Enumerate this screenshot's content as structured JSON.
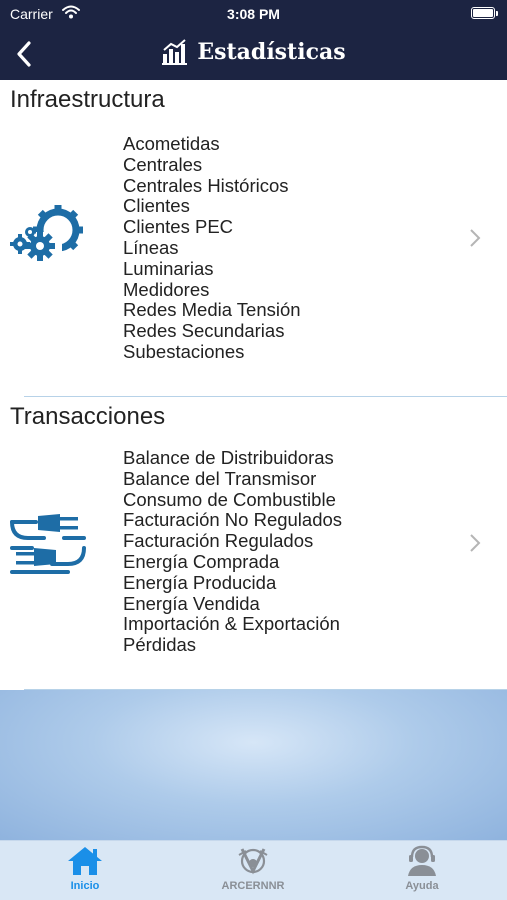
{
  "status_bar": {
    "carrier": "Carrier",
    "time": "3:08 PM"
  },
  "nav": {
    "title": "Estadísticas",
    "back_icon": "chevron-left-icon",
    "title_icon": "bar-chart-icon"
  },
  "sections": [
    {
      "title": "Infraestructura",
      "icon": "gears-icon",
      "items": [
        "Acometidas",
        "Centrales",
        "Centrales Históricos",
        "Clientes",
        "Clientes PEC",
        "Líneas",
        "Luminarias",
        "Medidores",
        "Redes Media Tensión",
        "Redes Secundarias",
        "Subestaciones"
      ]
    },
    {
      "title": "Transacciones",
      "icon": "plugs-icon",
      "items": [
        "Balance de Distribuidoras",
        "Balance del Transmisor",
        "Consumo de Combustible",
        "Facturación No Regulados",
        "Facturación Regulados",
        "Energía Comprada",
        "Energía Producida",
        "Energía Vendida",
        "Importación & Exportación",
        "Pérdidas"
      ]
    }
  ],
  "tabs": [
    {
      "label": "Inicio",
      "icon": "home-icon",
      "active": true
    },
    {
      "label": "ARCERNNR",
      "icon": "arcernnr-logo-icon",
      "active": false
    },
    {
      "label": "Ayuda",
      "icon": "support-agent-icon",
      "active": false
    }
  ],
  "colors": {
    "header_bg": "#1c2442",
    "accent": "#1a8fe8",
    "icon_blue": "#1e6da6",
    "tab_inactive": "#8a8f96",
    "divider": "#b7d2e8"
  }
}
